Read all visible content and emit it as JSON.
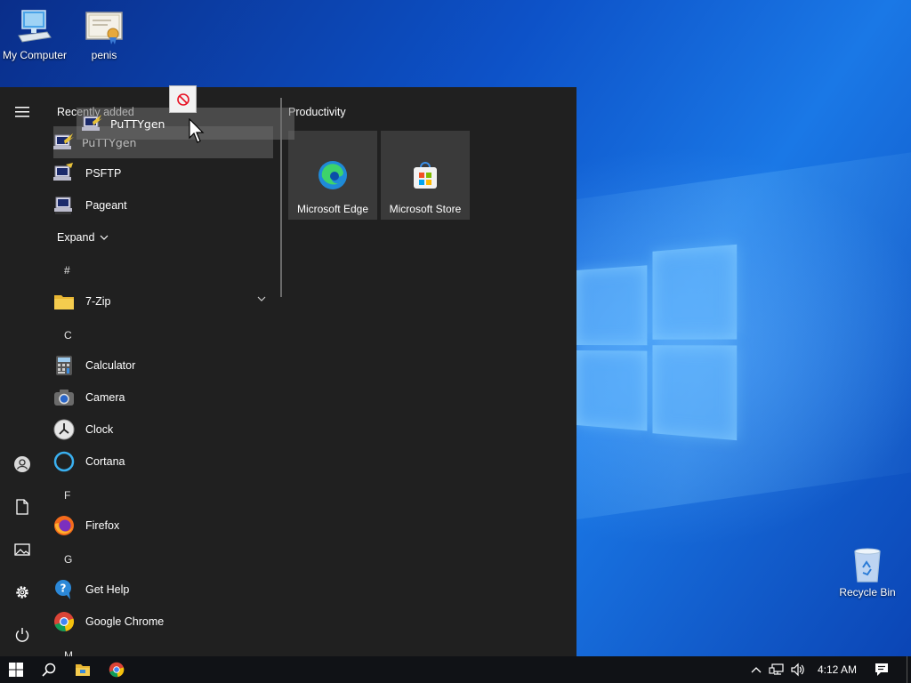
{
  "desktop": {
    "icons": [
      {
        "label": "My Computer",
        "icon": "computer-icon"
      },
      {
        "label": "penis",
        "icon": "certificate-icon"
      },
      {
        "label": "Recycle Bin",
        "icon": "recycle-bin-icon"
      }
    ]
  },
  "start_menu": {
    "recently_added_label": "Recently added",
    "recent_apps": [
      {
        "label": "PuTTYgen",
        "icon": "puttygen-icon"
      },
      {
        "label": "PSFTP",
        "icon": "psftp-icon"
      },
      {
        "label": "Pageant",
        "icon": "pageant-icon"
      }
    ],
    "expand_label": "Expand",
    "groups": [
      {
        "letter": "#",
        "apps": [
          {
            "label": "7-Zip",
            "icon": "folder-icon"
          }
        ]
      },
      {
        "letter": "C",
        "apps": [
          {
            "label": "Calculator",
            "icon": "calculator-icon"
          },
          {
            "label": "Camera",
            "icon": "camera-icon"
          },
          {
            "label": "Clock",
            "icon": "clock-icon"
          },
          {
            "label": "Cortana",
            "icon": "cortana-icon"
          }
        ]
      },
      {
        "letter": "F",
        "apps": [
          {
            "label": "Firefox",
            "icon": "firefox-icon"
          }
        ]
      },
      {
        "letter": "G",
        "apps": [
          {
            "label": "Get Help",
            "icon": "help-icon"
          },
          {
            "label": "Google Chrome",
            "icon": "chrome-icon"
          }
        ]
      },
      {
        "letter": "M",
        "apps": []
      }
    ],
    "tiles_group_label": "Productivity",
    "tiles": [
      {
        "label": "Microsoft Edge",
        "icon": "edge-icon"
      },
      {
        "label": "Microsoft Store",
        "icon": "store-icon"
      }
    ],
    "drag": {
      "label": "PuTTYgen"
    }
  },
  "taskbar": {
    "clock": "4:12 AM"
  },
  "colors": {
    "start_bg": "#202020",
    "tile_bg": "#3a3a3a",
    "taskbar_bg": "#101216"
  }
}
